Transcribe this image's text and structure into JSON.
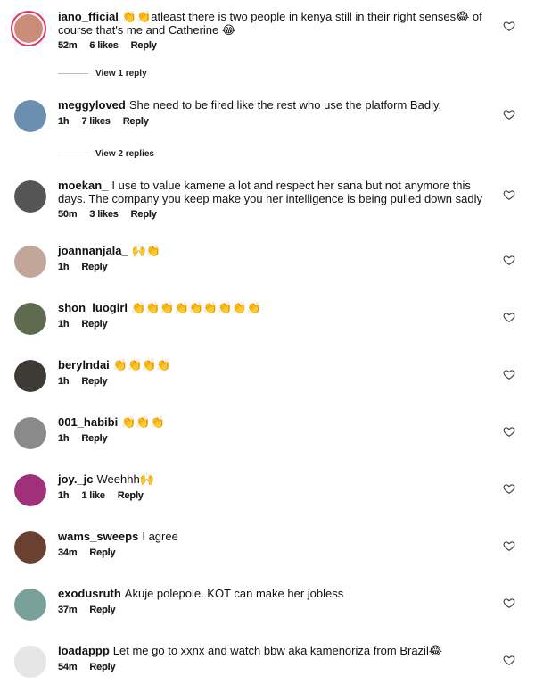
{
  "comments": [
    {
      "user": "iano_fficial",
      "text": "👏👏atleast there is two  people in kenya still in their right senses😂 of course that's me and Catherine 😂",
      "time": "52m",
      "likes": "6 likes",
      "reply": "Reply",
      "view_replies": "View 1 reply",
      "avatar_color": "#c98d7a"
    },
    {
      "user": "meggyloved",
      "text": "She need to be fired like the rest who use the platform Badly.",
      "time": "1h",
      "likes": "7 likes",
      "reply": "Reply",
      "view_replies": "View 2 replies",
      "avatar_color": "#6b8fb0"
    },
    {
      "user": "moekan_",
      "text": "I use to value kamene a lot and respect her sana but not anymore this days. The company you keep make you her intelligence is being pulled down sadly",
      "time": "50m",
      "likes": "3 likes",
      "reply": "Reply",
      "avatar_color": "#555555"
    },
    {
      "user": "joannanjala_",
      "text": "🙌👏",
      "time": "1h",
      "reply": "Reply",
      "avatar_color": "#c2a69a"
    },
    {
      "user": "shon_luogirl",
      "text": "👏👏👏👏👏👏👏👏👏",
      "time": "1h",
      "reply": "Reply",
      "avatar_color": "#5f6b4e"
    },
    {
      "user": "berylndai",
      "text": "👏👏👏👏",
      "time": "1h",
      "reply": "Reply",
      "avatar_color": "#3e3a36"
    },
    {
      "user": "001_habibi",
      "text": "👏👏👏",
      "time": "1h",
      "reply": "Reply",
      "avatar_color": "#8a8a8a"
    },
    {
      "user": "joy._jc",
      "text": "Weehhh🙌",
      "time": "1h",
      "likes": "1 like",
      "reply": "Reply",
      "avatar_color": "#a0307a"
    },
    {
      "user": "wams_sweeps",
      "text": "I agree",
      "time": "34m",
      "reply": "Reply",
      "avatar_color": "#6a4030"
    },
    {
      "user": "exodusruth",
      "text": "Akuje polepole. KOT can make her jobless",
      "time": "37m",
      "reply": "Reply",
      "avatar_color": "#7aa09a"
    },
    {
      "user": "loadappp",
      "text": "Let me go to xxnx and watch bbw aka kamenoriza from Brazil😂",
      "time": "54m",
      "reply": "Reply",
      "avatar_color": "#e6e6e6"
    }
  ],
  "colors": {
    "heart": "#444444",
    "story_ring": "#e1306c",
    "text": "#111111"
  },
  "icons": {
    "like": "heart-outline-icon"
  }
}
